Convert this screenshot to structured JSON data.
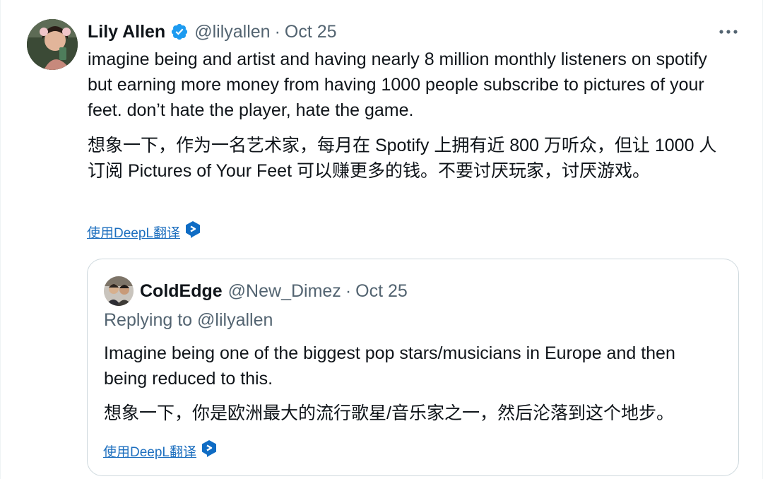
{
  "tweet": {
    "author_name": "Lily Allen",
    "handle": "@lilyallen",
    "separator": "·",
    "date": "Oct 25",
    "text": "imagine being and artist and having nearly 8 million monthly listeners on spotify but earning more money from having 1000 people subscribe to pictures of your feet. don’t hate the player, hate the game.",
    "translation": "想象一下，作为一名艺术家，每月在 Spotify 上拥有近 800 万听众，但让 1000 人订阅 Pictures of Your Feet 可以赚更多的钱。不要讨厌玩家，讨厌游戏。",
    "translate_link": "使用DeepL翻译",
    "more_icon": "more-horizontal-icon",
    "verified_icon": "verified-badge-icon"
  },
  "quoted": {
    "author_name": "ColdEdge",
    "handle": "@New_Dimez",
    "separator": "·",
    "date": "Oct 25",
    "reply_prefix": "Replying to",
    "reply_handle": "@lilyallen",
    "text": "Imagine being one of the biggest pop stars/musicians in Europe and then being reduced to this.",
    "translation": "想象一下，你是欧洲最大的流行歌星/音乐家之一，然后沦落到这个地步。",
    "translate_link": "使用DeepL翻译"
  },
  "colors": {
    "verified_blue": "#1d9bf0",
    "link_blue": "#1d6fbf",
    "deepl_badge": "#0f6cc4",
    "muted_text": "#536471",
    "border": "#cfd9de"
  }
}
